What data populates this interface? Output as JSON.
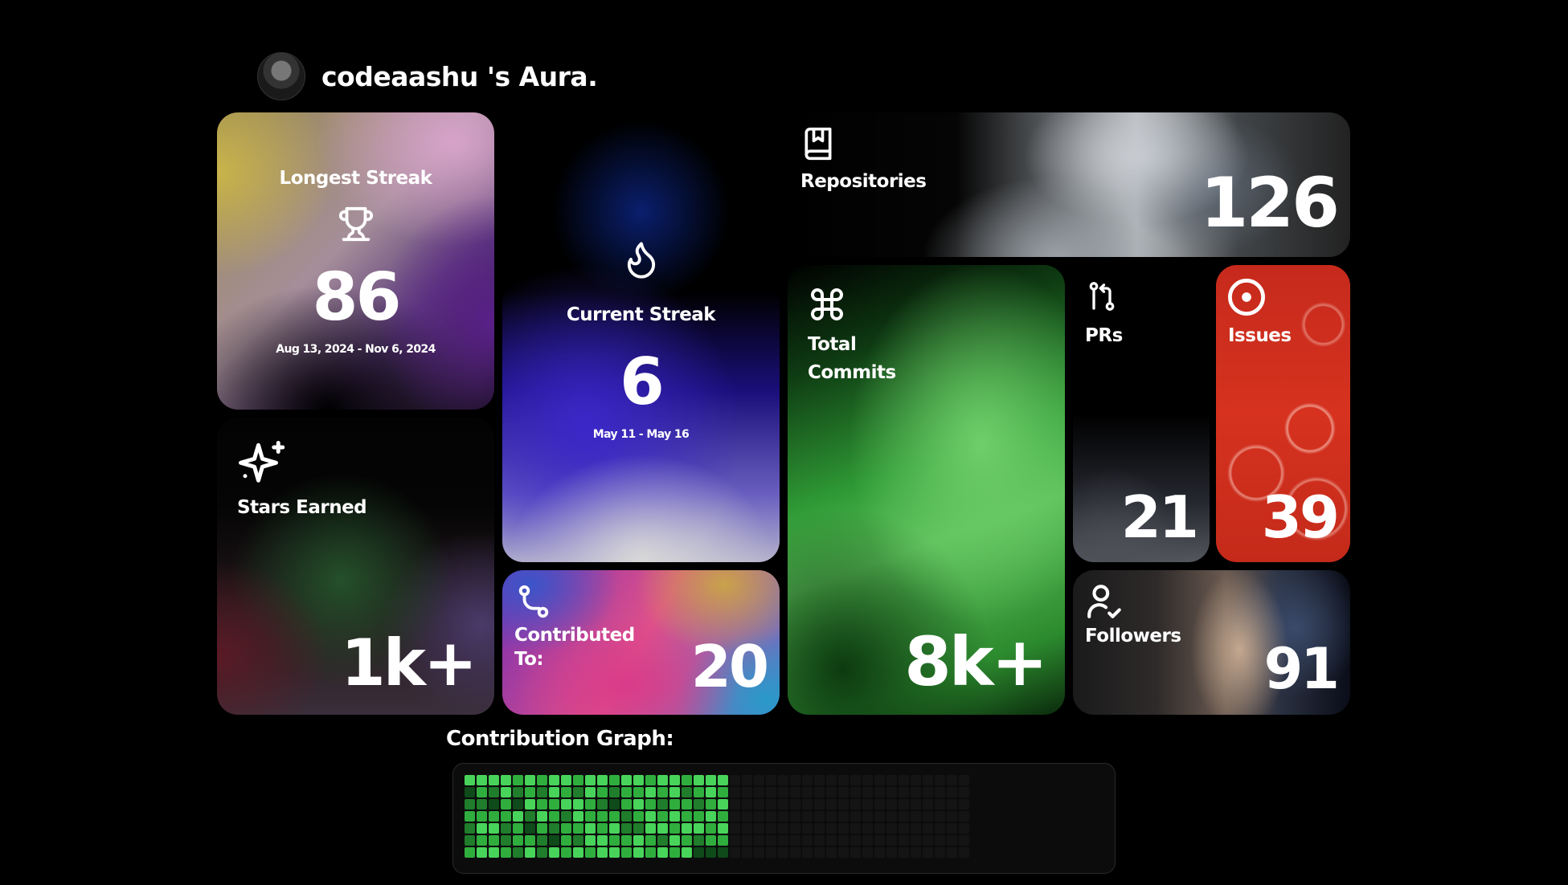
{
  "header": {
    "title": "codeaashu 's Aura."
  },
  "cards": {
    "longest_streak": {
      "label": "Longest Streak",
      "value": "86",
      "range": "Aug 13, 2024 - Nov 6, 2024"
    },
    "current_streak": {
      "label": "Current Streak",
      "value": "6",
      "range": "May 11 - May 16"
    },
    "stars": {
      "label": "Stars Earned",
      "value": "1k+"
    },
    "contributed": {
      "label_line1": "Contributed",
      "label_line2": "To:",
      "value": "20"
    },
    "repositories": {
      "label": "Repositories",
      "value": "126"
    },
    "commits": {
      "label_line1": "Total",
      "label_line2": "Commits",
      "value": "8k+"
    },
    "prs": {
      "label": "PRs",
      "value": "21"
    },
    "issues": {
      "label": "Issues",
      "value": "39"
    },
    "followers": {
      "label": "Followers",
      "value": "91"
    }
  },
  "icons": {
    "longest_streak": "trophy-icon",
    "current_streak": "flame-icon",
    "stars": "sparkles-icon",
    "contributed": "git-branch-icon",
    "repositories": "book-icon",
    "commits": "command-icon",
    "prs": "pull-request-icon",
    "issues": "issue-circle-icon",
    "followers": "user-check-icon"
  },
  "contribution_graph": {
    "title": "Contribution Graph:",
    "levels": [
      [
        3,
        0,
        1,
        2,
        1,
        1,
        2
      ],
      [
        3,
        2,
        1,
        2,
        3,
        2,
        3
      ],
      [
        3,
        1,
        0,
        2,
        3,
        2,
        3
      ],
      [
        3,
        3,
        2,
        2,
        1,
        1,
        2
      ],
      [
        2,
        1,
        0,
        3,
        2,
        2,
        1
      ],
      [
        3,
        2,
        3,
        1,
        0,
        2,
        3
      ],
      [
        2,
        1,
        2,
        3,
        2,
        1,
        1
      ],
      [
        3,
        3,
        2,
        2,
        1,
        0,
        3
      ],
      [
        3,
        2,
        3,
        1,
        2,
        2,
        2
      ],
      [
        2,
        1,
        3,
        3,
        2,
        1,
        3
      ],
      [
        3,
        3,
        2,
        2,
        3,
        3,
        2
      ],
      [
        3,
        2,
        1,
        2,
        2,
        3,
        3
      ],
      [
        2,
        1,
        0,
        2,
        3,
        2,
        3
      ],
      [
        3,
        2,
        2,
        1,
        1,
        2,
        2
      ],
      [
        3,
        2,
        3,
        2,
        1,
        3,
        3
      ],
      [
        2,
        3,
        2,
        3,
        3,
        2,
        2
      ],
      [
        3,
        2,
        1,
        2,
        3,
        1,
        3
      ],
      [
        3,
        3,
        2,
        3,
        2,
        3,
        2
      ],
      [
        2,
        1,
        2,
        2,
        3,
        2,
        3
      ],
      [
        3,
        2,
        1,
        2,
        3,
        1,
        0
      ],
      [
        3,
        3,
        2,
        3,
        2,
        2,
        0
      ],
      [
        3,
        2,
        3,
        2,
        3,
        2,
        0
      ]
    ],
    "total_weeks": 42
  }
}
